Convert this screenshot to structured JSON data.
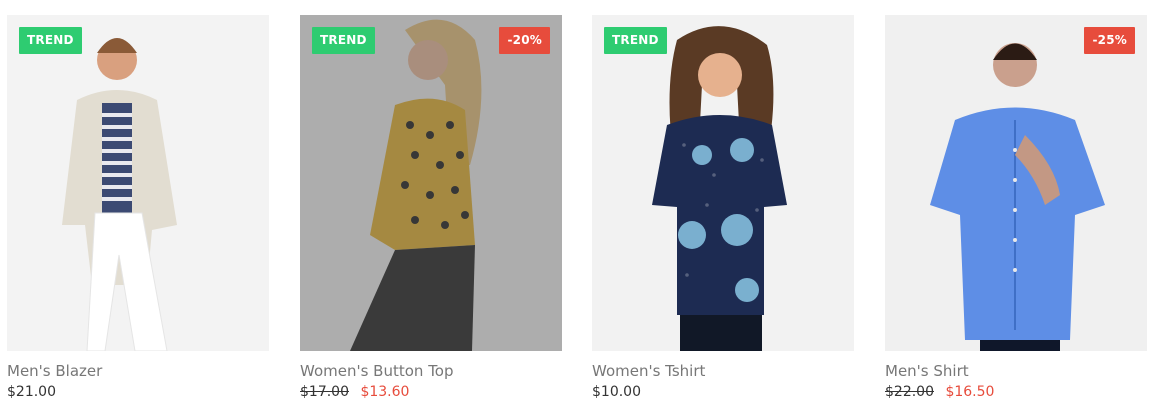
{
  "products": [
    {
      "name": "Men's Blazer",
      "badge_left": "TREND",
      "badge_right": "",
      "price": "$21.00",
      "old_price": "",
      "new_price": ""
    },
    {
      "name": "Women's Button Top",
      "badge_left": "TREND",
      "badge_right": "-20%",
      "price": "",
      "old_price": "$17.00",
      "new_price": "$13.60"
    },
    {
      "name": "Women's Tshirt",
      "badge_left": "TREND",
      "badge_right": "",
      "price": "$10.00",
      "old_price": "",
      "new_price": ""
    },
    {
      "name": "Men's Shirt",
      "badge_left": "",
      "badge_right": "-25%",
      "price": "",
      "old_price": "$22.00",
      "new_price": "$16.50"
    }
  ],
  "colors": {
    "trend_badge": "#2ecc71",
    "sale_badge": "#e74c3c",
    "product_name": "#777777",
    "price": "#333333",
    "sale_price": "#e74c3c"
  }
}
